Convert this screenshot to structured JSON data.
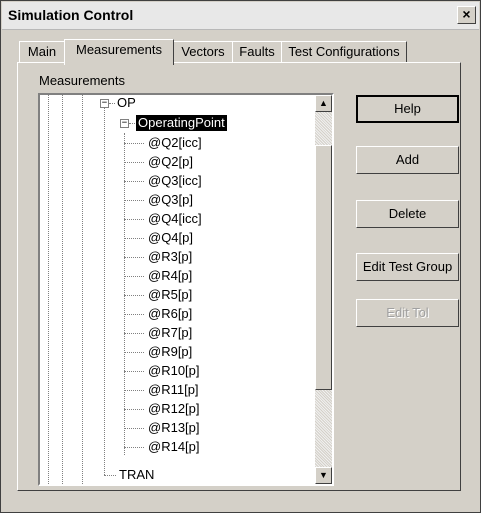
{
  "window": {
    "title": "Simulation Control",
    "close_glyph": "×"
  },
  "tabs": [
    {
      "label": "Main"
    },
    {
      "label": "Measurements"
    },
    {
      "label": "Vectors"
    },
    {
      "label": "Faults"
    },
    {
      "label": "Test Configurations"
    }
  ],
  "active_tab": "Measurements",
  "group_label": "Measurements",
  "tree": {
    "op": {
      "label": "OP",
      "expander": "−"
    },
    "operating_point": {
      "label": "OperatingPoint",
      "expander": "−"
    },
    "items": [
      "@Q2[icc]",
      "@Q2[p]",
      "@Q3[icc]",
      "@Q3[p]",
      "@Q4[icc]",
      "@Q4[p]",
      "@R3[p]",
      "@R4[p]",
      "@R5[p]",
      "@R6[p]",
      "@R7[p]",
      "@R9[p]",
      "@R10[p]",
      "@R11[p]",
      "@R12[p]",
      "@R13[p]",
      "@R14[p]"
    ],
    "tran": {
      "label": "TRAN"
    }
  },
  "scrollbar": {
    "up_glyph": "▲",
    "down_glyph": "▼"
  },
  "buttons": {
    "help": "Help",
    "add": "Add",
    "delete": "Delete",
    "edit_test_group": "Edit Test Group",
    "edit_tol": "Edit Tol"
  }
}
